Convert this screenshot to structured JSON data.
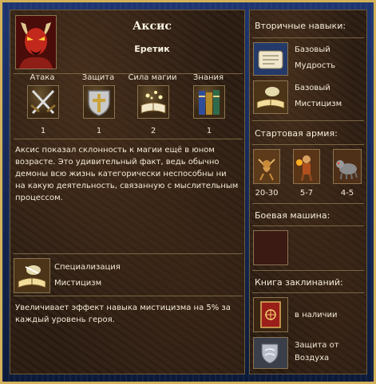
{
  "hero": {
    "name": "Аксис",
    "class": "Еретик",
    "portrait_icon": "demon-portrait-icon"
  },
  "stats": [
    {
      "label": "Атака",
      "value": "1",
      "icon": "crossed-swords-icon"
    },
    {
      "label": "Защита",
      "value": "1",
      "icon": "shield-icon"
    },
    {
      "label": "Сила магии",
      "value": "2",
      "icon": "magic-book-icon"
    },
    {
      "label": "Знания",
      "value": "1",
      "icon": "books-icon"
    }
  ],
  "bio": "Аксис показал склонность к магии ещё в юном возрасте. Это удивительный факт, ведь обычно демоны всю жизнь категорически неспособны ни на какую деятельность, связанную с мыслительным процессом.",
  "specialty": {
    "header": "Специализация",
    "name": "Мистицизм",
    "description": "Увеличивает эффект навыка мистицизма на 5% за каждый уровень героя.",
    "icon": "glowing-book-icon"
  },
  "secondary_skills": {
    "header": "Вторичные навыки:",
    "items": [
      {
        "line1": "Базовый",
        "line2": "Мудрость",
        "icon": "scroll-icon"
      },
      {
        "line1": "Базовый",
        "line2": "Мистицизм",
        "icon": "glowing-book-icon"
      }
    ]
  },
  "army": {
    "header": "Стартовая армия:",
    "units": [
      {
        "count": "20-30",
        "icon": "imp-icon"
      },
      {
        "count": "5-7",
        "icon": "gog-icon"
      },
      {
        "count": "4-5",
        "icon": "hell-hound-icon"
      }
    ]
  },
  "war_machine": {
    "header": "Боевая машина:"
  },
  "spellbook": {
    "header": "Книга заклинаний:",
    "book_label": "в наличии",
    "spell_line1": "Защита от",
    "spell_line2": "Воздуха",
    "book_icon": "spellbook-icon",
    "spell_icon": "air-protection-icon"
  },
  "colors": {
    "frame_gold": "#d4b25a",
    "frame_blue": "#1d3570",
    "text": "#f3ead5"
  }
}
